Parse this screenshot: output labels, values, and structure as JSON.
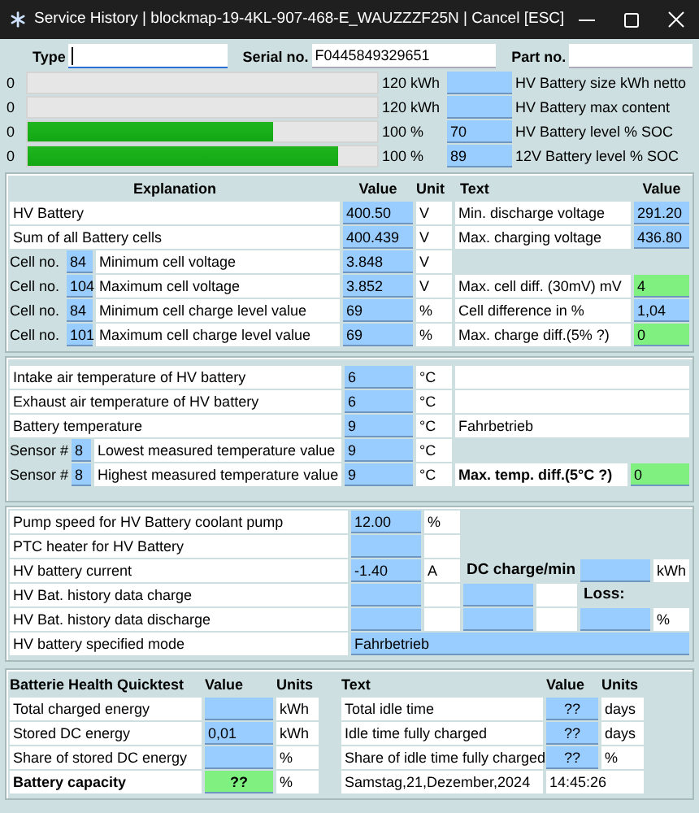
{
  "window": {
    "title": "Service History | blockmap-19-4KL-907-468-E_WAUZZZF25N | Cancel [ESC]"
  },
  "header_fields": [
    {
      "label": "Type",
      "focused": true
    },
    {
      "label": "Serial no.",
      "value": "F0445849329651",
      "focused": false
    },
    {
      "label": "Part no.",
      "focused": false
    }
  ],
  "gauges": [
    {
      "count": "0",
      "level": 0,
      "maximum": "120 kWh",
      "label": "HV Battery size kWh netto"
    },
    {
      "count": "0",
      "level": 0,
      "maximum": "120 kWh",
      "label": "HV Battery max content"
    },
    {
      "count": "0",
      "level": 0.7,
      "maximum": "100 %",
      "value": "70",
      "label": "HV Battery level % SOC"
    },
    {
      "count": "0",
      "level": 0.89,
      "maximum": "100 %",
      "value": "89",
      "label": "12V Battery level % SOC"
    }
  ],
  "cell_table": {
    "columns": [
      "Explanation",
      "Value",
      "Unit",
      "Text",
      "Value"
    ],
    "rows": [
      {
        "kind": "pack",
        "explanation": "HV Battery",
        "value": "400.50",
        "unit": "V",
        "text": "Min. discharge voltage",
        "text_value": "291.20",
        "color": "#99ccff"
      },
      {
        "kind": "pack",
        "explanation": "Sum of all Battery cells",
        "value": "400.439",
        "unit": "V",
        "text": "Max. charging voltage",
        "text_value": "436.80",
        "color": "#99ccff"
      },
      {
        "kind": "cell",
        "cell_label": "Cell no.",
        "cell_no": "84",
        "explanation": "Minimum cell voltage",
        "value": "3.848",
        "unit": "V"
      },
      {
        "kind": "cell",
        "cell_label": "Cell no.",
        "cell_no": "104",
        "explanation": "Maximum cell voltage",
        "value": "3.852",
        "unit": "V",
        "text": "Max. cell diff. (30mV) mV",
        "text_value": "4",
        "color": "#80f080"
      },
      {
        "kind": "cell",
        "cell_label": "Cell no.",
        "cell_no": "84",
        "explanation": "Minimum cell charge level value",
        "value": "69",
        "unit": "%",
        "text": "Cell difference in %",
        "text_value": "1,04",
        "color": "#99ccff"
      },
      {
        "kind": "cell",
        "cell_label": "Cell no.",
        "cell_no": "101",
        "explanation": "Maximum cell charge level value",
        "value": "69",
        "unit": "%",
        "text": "Max. charge diff.(5% ?)",
        "text_value": "0",
        "color": "#80f080"
      }
    ]
  },
  "temperature_table": {
    "rows": [
      {
        "kind": "plain",
        "explanation": "Intake air temperature of HV battery",
        "value": "6",
        "unit": "°C",
        "side": {
          "kind": "blank"
        }
      },
      {
        "kind": "plain",
        "explanation": "Exhaust air temperature of HV battery",
        "value": "6",
        "unit": "°C",
        "side": {
          "kind": "blank"
        }
      },
      {
        "kind": "plain",
        "explanation": "Battery temperature",
        "value": "9",
        "unit": "°C",
        "side": {
          "kind": "text",
          "text": "Fahrbetrieb"
        }
      },
      {
        "kind": "sensor",
        "sensor_label": "Sensor #",
        "sensor_no": "8",
        "explanation": "Lowest measured temperature value",
        "value": "9",
        "unit": "°C"
      },
      {
        "kind": "sensor",
        "sensor_label": "Sensor #",
        "sensor_no": "8",
        "explanation": "Highest measured temperature value",
        "value": "9",
        "unit": "°C",
        "side": {
          "kind": "check",
          "text": "Max. temp. diff.(5°C ?)",
          "value": "0",
          "color": "#80f080"
        }
      }
    ]
  },
  "coolant_table": {
    "rows": [
      {
        "kind": "plain",
        "explanation": "Pump speed for HV Battery coolant pump",
        "value": "12.00",
        "unit": "%"
      },
      {
        "kind": "plain",
        "explanation": "PTC heater for HV Battery"
      },
      {
        "kind": "plain",
        "explanation": "HV battery current",
        "value": "-1.40",
        "unit": "A",
        "extras": [
          {
            "kind": "heading",
            "text": "DC charge/min"
          },
          {
            "kind": "field"
          },
          {
            "kind": "box",
            "text": "kWh"
          }
        ]
      },
      {
        "kind": "plain",
        "explanation": "HV Bat. history data charge",
        "extras": [
          {
            "kind": "field"
          },
          {
            "kind": "box"
          },
          {
            "kind": "heading",
            "text": "Loss:"
          }
        ]
      },
      {
        "kind": "plain",
        "explanation": "HV Bat. history data discharge",
        "extras": [
          {
            "kind": "field"
          },
          {
            "kind": "box"
          },
          {
            "kind": "field"
          },
          {
            "kind": "box",
            "text": "%"
          }
        ]
      },
      {
        "kind": "mode",
        "explanation": "HV battery specified mode",
        "value": "Fahrbetrieb"
      }
    ]
  },
  "quicktest": {
    "columns": [
      "Batterie Health Quicktest",
      "Value",
      "Units",
      "Text",
      "Value",
      "Units"
    ],
    "rows": [
      {
        "kind": "metric",
        "label": "Total charged energy",
        "unit": "kWh",
        "color": "#99ccff",
        "text": "Total idle time",
        "text_value": "??",
        "text_unit": "days"
      },
      {
        "kind": "metric",
        "label": "Stored DC energy",
        "value": "0,01",
        "unit": "kWh",
        "color": "#99ccff",
        "text": "Idle time fully charged",
        "text_value": "??",
        "text_unit": "days"
      },
      {
        "kind": "metric",
        "label": "Share of stored DC energy",
        "unit": "%",
        "color": "#99ccff",
        "text": "Share of idle time fully charged",
        "text_value": "??",
        "text_unit": "%"
      },
      {
        "kind": "summary",
        "label": "Battery capacity",
        "value": "??",
        "unit": "%",
        "color": "#80f080",
        "text": "Samstag,21,Dezember,2024",
        "text_value": "14:45:26"
      }
    ]
  }
}
